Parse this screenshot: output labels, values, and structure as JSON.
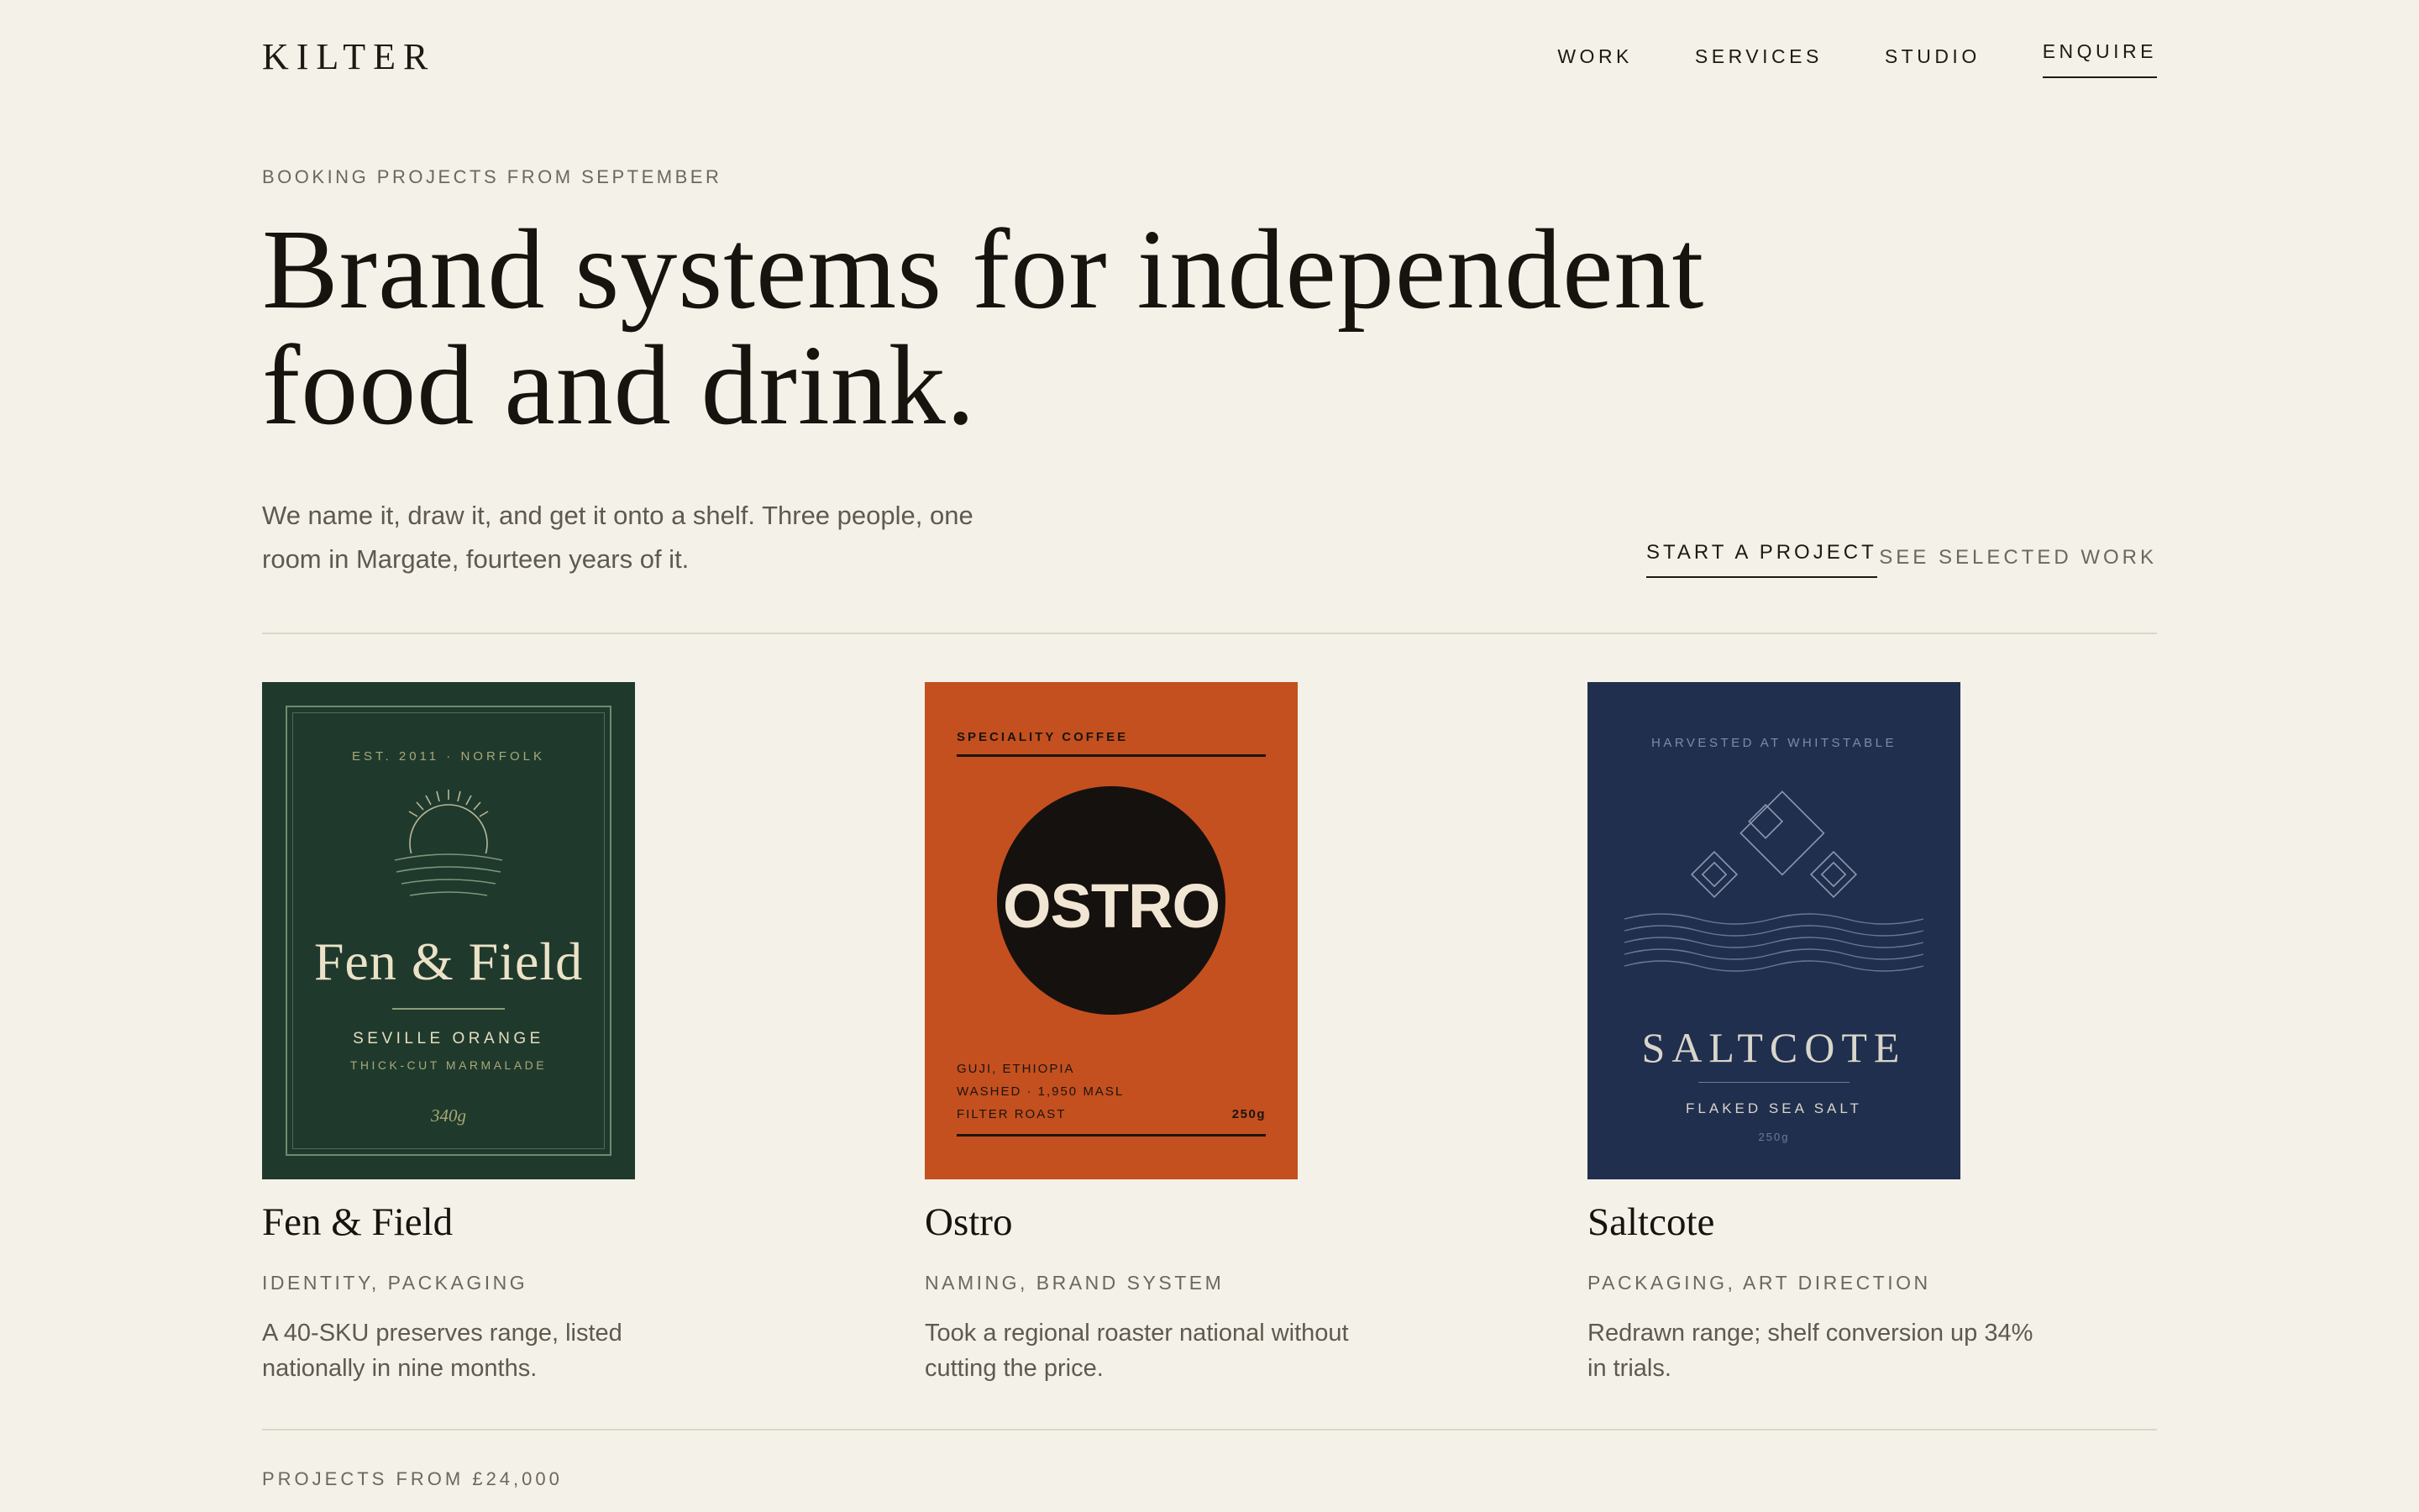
{
  "header": {
    "brand": "KILTER",
    "nav": [
      "WORK",
      "SERVICES",
      "STUDIO",
      "ENQUIRE"
    ]
  },
  "hero": {
    "eyebrow": "BOOKING PROJECTS FROM SEPTEMBER",
    "headline_line1": "Brand systems for independent",
    "headline_line2": "food and drink.",
    "intro_line1": "We name it, draw it, and get it onto a shelf. Three people, one",
    "intro_line2": "room in Margate, fourteen years of it.",
    "cta_primary": "START A PROJECT",
    "cta_secondary": "SEE SELECTED WORK"
  },
  "projects": [
    {
      "title": "Fen & Field",
      "tags": "IDENTITY, PACKAGING",
      "desc_line1": "A 40-SKU preserves range, listed",
      "desc_line2": "nationally in nine months.",
      "cover": {
        "est": "EST. 2011 · NORFOLK",
        "name": "Fen & Field",
        "product": "SEVILLE ORANGE",
        "variant": "THICK-CUT MARMALADE",
        "weight": "340g"
      }
    },
    {
      "title": "Ostro",
      "tags": "NAMING, BRAND SYSTEM",
      "desc_line1": "Took a regional roaster national without",
      "desc_line2": "cutting the price.",
      "cover": {
        "top": "SPECIALITY COFFEE",
        "word": "OSTRO",
        "origin": "GUJI, ETHIOPIA",
        "process": "WASHED · 1,950 MASL",
        "roast": "FILTER ROAST",
        "weight": "250g"
      }
    },
    {
      "title": "Saltcote",
      "tags": "PACKAGING, ART DIRECTION",
      "desc_line1": "Redrawn range; shelf conversion up 34%",
      "desc_line2": "in trials.",
      "cover": {
        "top": "HARVESTED AT WHITSTABLE",
        "name": "SALTCOTE",
        "product": "FLAKED SEA SALT",
        "weight": "250g"
      }
    }
  ],
  "footer": {
    "pricing": "PROJECTS FROM £24,000"
  },
  "colors": {
    "background": "#f4f1e8",
    "ink": "#17140f",
    "muted": "#6d675c",
    "fen_green": "#1f3a2c",
    "ostro_orange": "#c4501f",
    "saltcote_navy": "#212f4e"
  }
}
